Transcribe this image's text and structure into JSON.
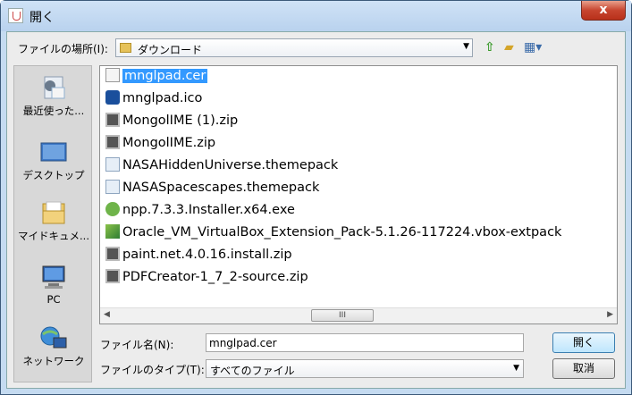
{
  "window": {
    "title": "開く",
    "close_label": "x"
  },
  "lookin": {
    "label": "ファイルの場所(I):",
    "value": "ダウンロード"
  },
  "toolbar": {
    "up_icon": "up-arrow-icon",
    "new_folder_icon": "new-folder-icon",
    "view_icon": "view-menu-icon"
  },
  "places": [
    {
      "label": "最近使った...",
      "icon": "recent-icon"
    },
    {
      "label": "デスクトップ",
      "icon": "desktop-icon"
    },
    {
      "label": "マイドキュメ...",
      "icon": "documents-icon"
    },
    {
      "label": "PC",
      "icon": "computer-icon"
    },
    {
      "label": "ネットワーク",
      "icon": "network-icon"
    }
  ],
  "files": [
    {
      "name": "mnglpad.cer",
      "icon": "certificate-icon",
      "selected": true
    },
    {
      "name": "mnglpad.ico",
      "icon": "image-icon"
    },
    {
      "name": "MongolIME (1).zip",
      "icon": "zip-icon"
    },
    {
      "name": "MongolIME.zip",
      "icon": "zip-icon"
    },
    {
      "name": "NASAHiddenUniverse.themepack",
      "icon": "themepack-icon"
    },
    {
      "name": "NASASpacescapes.themepack",
      "icon": "themepack-icon"
    },
    {
      "name": "npp.7.3.3.Installer.x64.exe",
      "icon": "installer-icon"
    },
    {
      "name": "Oracle_VM_VirtualBox_Extension_Pack-5.1.26-117224.vbox-extpack",
      "icon": "package-icon"
    },
    {
      "name": "paint.net.4.0.16.install.zip",
      "icon": "zip-icon"
    },
    {
      "name": "PDFCreator-1_7_2-source.zip",
      "icon": "zip-icon"
    }
  ],
  "scrollbar": {
    "thumb_grip": "III"
  },
  "filename": {
    "label": "ファイル名(N):",
    "value": "mnglpad.cer"
  },
  "filetype": {
    "label": "ファイルのタイプ(T):",
    "value": "すべてのファイル"
  },
  "buttons": {
    "open": "開く",
    "cancel": "取消"
  }
}
